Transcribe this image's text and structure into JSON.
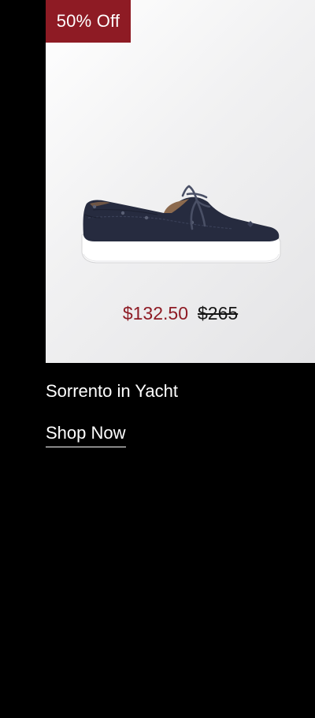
{
  "product": {
    "badge": "50% Off",
    "sale_price": "$132.50",
    "original_price": "$265",
    "name": "Sorrento in Yacht",
    "cta": "Shop Now",
    "image_icon": "boat-shoe-image"
  },
  "colors": {
    "badge_bg": "#8e1b24",
    "sale_price": "#8e1b24",
    "page_bg": "#000000",
    "shoe_upper": "#262b3f",
    "shoe_sole": "#ffffff"
  }
}
